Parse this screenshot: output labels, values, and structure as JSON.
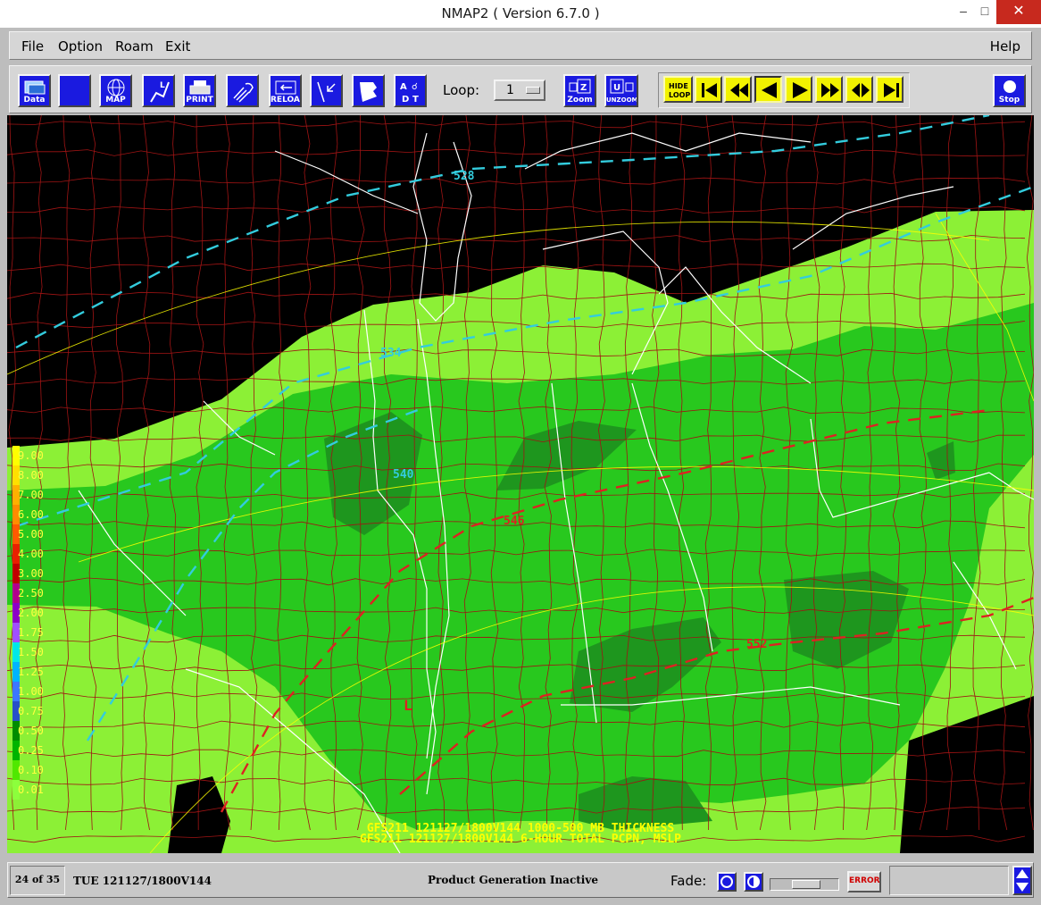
{
  "window": {
    "title": "NMAP2 ( Version 6.7.0 )",
    "min_glyph": "–",
    "max_glyph": "□",
    "close_glyph": "✕"
  },
  "menubar": {
    "items": [
      "File",
      "Option",
      "Roam",
      "Exit"
    ],
    "help": "Help"
  },
  "toolbar": {
    "buttons": [
      {
        "name": "data",
        "label": "Data",
        "icon": "data-icon"
      },
      {
        "name": "blank",
        "label": "",
        "icon": "blank-icon"
      },
      {
        "name": "map",
        "label": "MAP",
        "icon": "globe-icon"
      },
      {
        "name": "locator",
        "label": "",
        "icon": "locator-icon"
      },
      {
        "name": "print",
        "label": "PRINT",
        "icon": "printer-icon"
      },
      {
        "name": "clear",
        "label": "",
        "icon": "hand-sweep-icon"
      },
      {
        "name": "reload",
        "label": "RELOAD",
        "icon": "reload-icon"
      },
      {
        "name": "cursor",
        "label": "",
        "icon": "cursor-arrow-icon"
      },
      {
        "name": "wipe",
        "label": "",
        "icon": "wipe-icon"
      },
      {
        "name": "annotate",
        "label": "",
        "icon": "text-symbols-icon"
      }
    ],
    "loop_label": "Loop:",
    "loop_value": "1",
    "zoom_label": "Zoom",
    "unzoom_label": "UNZOOM",
    "hide_loop_label": "HIDE LOOP",
    "anim_controls": [
      "first-frame",
      "step-back",
      "play-backward",
      "play-forward",
      "step-forward",
      "rock",
      "last-frame"
    ],
    "stop_label": "Stop"
  },
  "legend": {
    "items": [
      {
        "label": "9.00",
        "color": "#ffff00"
      },
      {
        "label": "8.00",
        "color": "#ffe000"
      },
      {
        "label": "7.00",
        "color": "#ffb000"
      },
      {
        "label": "6.00",
        "color": "#ff8c00"
      },
      {
        "label": "5.00",
        "color": "#ff5a00"
      },
      {
        "label": "4.00",
        "color": "#e82000"
      },
      {
        "label": "3.00",
        "color": "#c00000"
      },
      {
        "label": "2.50",
        "color": "#b0008c"
      },
      {
        "label": "2.00",
        "color": "#8c00c8"
      },
      {
        "label": "1.75",
        "color": "#a050ff"
      },
      {
        "label": "1.50",
        "color": "#00e8e8"
      },
      {
        "label": "1.25",
        "color": "#00b4ff"
      },
      {
        "label": "1.00",
        "color": "#3c78ff"
      },
      {
        "label": "0.75",
        "color": "#2850c8"
      },
      {
        "label": "0.50",
        "color": "#008c00"
      },
      {
        "label": "0.25",
        "color": "#00b400"
      },
      {
        "label": "0.10",
        "color": "#50e800"
      },
      {
        "label": "0.01",
        "color": "#8cff3c"
      }
    ]
  },
  "contour_labels": [
    "528",
    "534",
    "540",
    "546",
    "552"
  ],
  "low_marker": "L",
  "map_caption": {
    "line1": "GFS211 121127/1800V144 1000-500 MB THICKNESS",
    "line2": "GFS211 121127/1800V144 6-HOUR TOTAL PCPN, MSLP"
  },
  "statusbar": {
    "frame_counter": "24 of 35",
    "frame_time": "TUE 121127/1800V144",
    "product_status": "Product Generation Inactive",
    "fade_label": "Fade:",
    "error_label": "ERROR"
  },
  "colors": {
    "precip_light": "#8cf036",
    "precip_mid": "#28c81e",
    "precip_heavy": "#1e961e",
    "thickness_cold": "#33ccdd",
    "thickness_warm": "#dd2222",
    "county_lines": "#a01414",
    "state_lines": "#ffffff",
    "latlon": "#ffff00"
  }
}
